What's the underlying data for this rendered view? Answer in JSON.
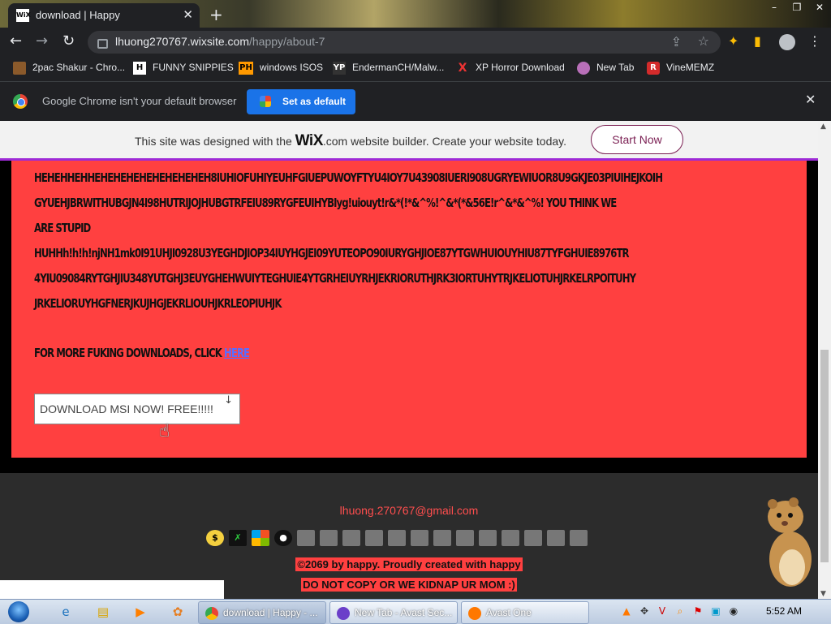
{
  "browser": {
    "tab_title": "download | Happy",
    "tab_favicon": "WiX",
    "new_tab_symbol": "+",
    "url_host": "lhuong270767.wixsite.com",
    "url_path": "/happy/about-7",
    "bookmarks": [
      {
        "label": "2pac Shakur - Chro...",
        "icon": "2pac-icon"
      },
      {
        "label": "FUNNY SNIPPIES",
        "icon": "H"
      },
      {
        "label": "windows ISOS",
        "icon": "PH"
      },
      {
        "label": "EndermanCH/Malw...",
        "icon": "YP"
      },
      {
        "label": "XP Horror Download",
        "icon": "X"
      },
      {
        "label": "New Tab",
        "icon": "avast-icon"
      },
      {
        "label": "VineMEMZ",
        "icon": "R"
      }
    ],
    "infobar": {
      "message": "Google Chrome isn't your default browser",
      "button": "Set as default"
    }
  },
  "wix_banner": {
    "prefix": "This site was designed with the",
    "brand": "WiX",
    "suffix": ".com website builder. Create your website today.",
    "button": "Start Now"
  },
  "content": {
    "lines": [
      "HEHEHHEHHEHEHEHEHEHEHEHEHEH8IUHIOFUHIYEUHFGIUEPUWOYFTYU4IOY7U43908IUERI908UGRYEWIUOR8U9GKJE03PIUIHEJKOIH",
      "GYUEHJBRWITHUBGJN4I98HUTRIJOJHUBGTRFEIU89RYGFEUIHYBIyg!uiouyt!r&*(!*&^%!^&*(*&56E!r^&*&^%! YOU THINK WE",
      "ARE STUPID",
      "HUHHh!h!h!njNH1mk0I91UHJI0928U3YEGHDJIOP34IUYHGJEI09YUTEOPO90IURYGHJIOE87YTGWHUIOUYHIU87TYFGHUIE8976TR",
      "4YIU09084RYTGHJIU348YUTGHJ3EUYGHEHWUIYTEGHUIE4YTGRHEIUYRHJEKRIORUTHJRK3IORTUHYTRJKELIOTUHJRKELRPOITUHY",
      "JRKELIORUYHGFNERJKUJHGJEKRLIOUHJKRLEOPIUHJK"
    ],
    "more_prefix": "FOR MORE FUKING DOWNLOADS, CLICK",
    "more_link": "HERE",
    "download_button": "DOWNLOAD MSI NOW! FREE!!!!!",
    "download_arrow": "↓"
  },
  "footer": {
    "email": "lhuong.270767@gmail.com",
    "copyright": "©2069 by happy. Proudly created with happy",
    "warning": "DO NOT COPY OR WE KIDNAP UR MOM :)"
  },
  "taskbar": {
    "tasks": [
      {
        "label": "download | Happy - ...",
        "icon": "chrome-icon"
      },
      {
        "label": "New Tab - Avast Sec...",
        "icon": "avast-browser-icon"
      },
      {
        "label": "Avast One",
        "icon": "avast-one-icon"
      }
    ],
    "clock": "5:52 AM"
  },
  "colors": {
    "page_red": "#ff4040",
    "footer_bg": "#2c2c2c",
    "email_red": "#ff4e4e",
    "chrome_blue": "#1a73e8",
    "wix_border": "#9e2bd6"
  }
}
